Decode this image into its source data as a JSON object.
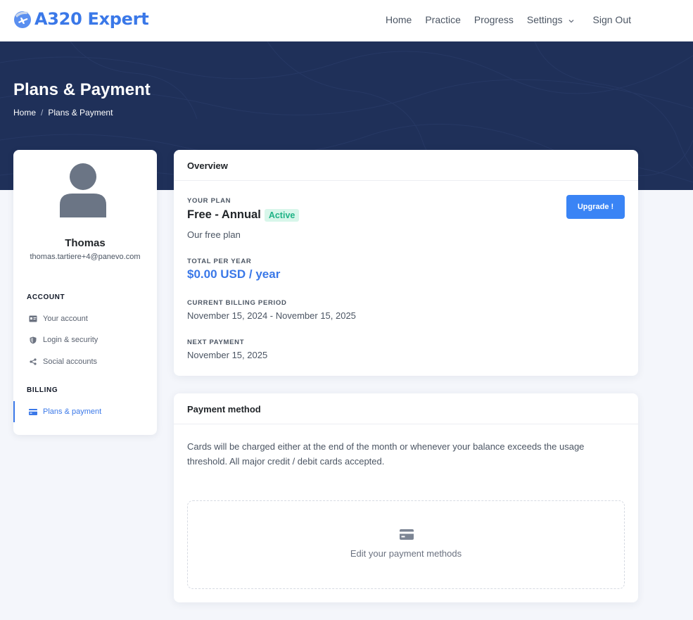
{
  "brand": {
    "name": "A320 Expert"
  },
  "nav": {
    "home": "Home",
    "practice": "Practice",
    "progress": "Progress",
    "settings": "Settings",
    "signout": "Sign Out"
  },
  "header": {
    "title": "Plans & Payment",
    "breadcrumb": [
      "Home",
      "/",
      "Plans & Payment"
    ]
  },
  "sidebar": {
    "user_name": "Thomas",
    "user_email": "thomas.tartiere+4@panevo.com",
    "account_section": "ACCOUNT",
    "billing_section": "BILLING",
    "items": [
      {
        "label": "Your account",
        "icon": "id-card-icon"
      },
      {
        "label": "Login & security",
        "icon": "shield-icon"
      },
      {
        "label": "Social accounts",
        "icon": "share-icon"
      },
      {
        "label": "Plans & payment",
        "icon": "credit-card-icon",
        "active": true
      }
    ]
  },
  "overview": {
    "title": "Overview",
    "your_plan_label": "YOUR PLAN",
    "plan_name": "Free - Annual",
    "plan_status": "Active",
    "plan_description": "Our free plan",
    "upgrade_button": "Upgrade !",
    "total_label": "TOTAL PER YEAR",
    "total_value": "$0.00 USD / year",
    "billing_period_label": "CURRENT BILLING PERIOD",
    "billing_period_value": "November 15, 2024 - November 15, 2025",
    "next_payment_label": "NEXT PAYMENT",
    "next_payment_value": "November 15, 2025"
  },
  "payment": {
    "title": "Payment method",
    "description": "Cards will be charged either at the end of the month or whenever your balance exceeds the usage threshold. All major credit / debit cards accepted.",
    "edit_label": "Edit your payment methods"
  },
  "colors": {
    "accent": "#3a78e8",
    "hero": "#1f3059",
    "active_badge_bg": "#d8f6ea",
    "active_badge_text": "#1fb386"
  }
}
